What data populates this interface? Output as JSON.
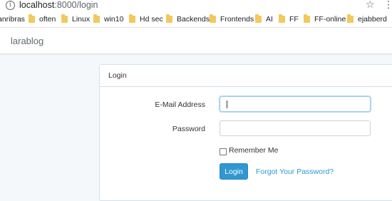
{
  "browser": {
    "url_host": "localhost",
    "url_rest": ":8000/login",
    "bookmarks": [
      {
        "label": "anribras",
        "folder": false
      },
      {
        "label": "often",
        "folder": true
      },
      {
        "label": "Linux",
        "folder": true
      },
      {
        "label": "win10",
        "folder": true
      },
      {
        "label": "Hd sec",
        "folder": true
      },
      {
        "label": "Backends",
        "folder": true
      },
      {
        "label": "Frontends",
        "folder": true
      },
      {
        "label": "AI",
        "folder": true
      },
      {
        "label": "FF",
        "folder": true
      },
      {
        "label": "FF-online",
        "folder": true
      },
      {
        "label": "ejabberd",
        "folder": true
      }
    ],
    "info_icon": "info-icon",
    "star_icon": "star-icon",
    "menu_icon": "menu-icon"
  },
  "navbar": {
    "brand": "larablog"
  },
  "panel": {
    "heading": "Login",
    "email_label": "E-Mail Address",
    "email_value": "",
    "password_label": "Password",
    "password_value": "",
    "remember_label": "Remember Me",
    "remember_checked": false,
    "login_button": "Login",
    "forgot_link": "Forgot Your Password?"
  },
  "colors": {
    "page_bg": "#f5f8fa",
    "primary": "#3097d1",
    "border": "#d3e0e9",
    "folder": "#f3c95d"
  }
}
